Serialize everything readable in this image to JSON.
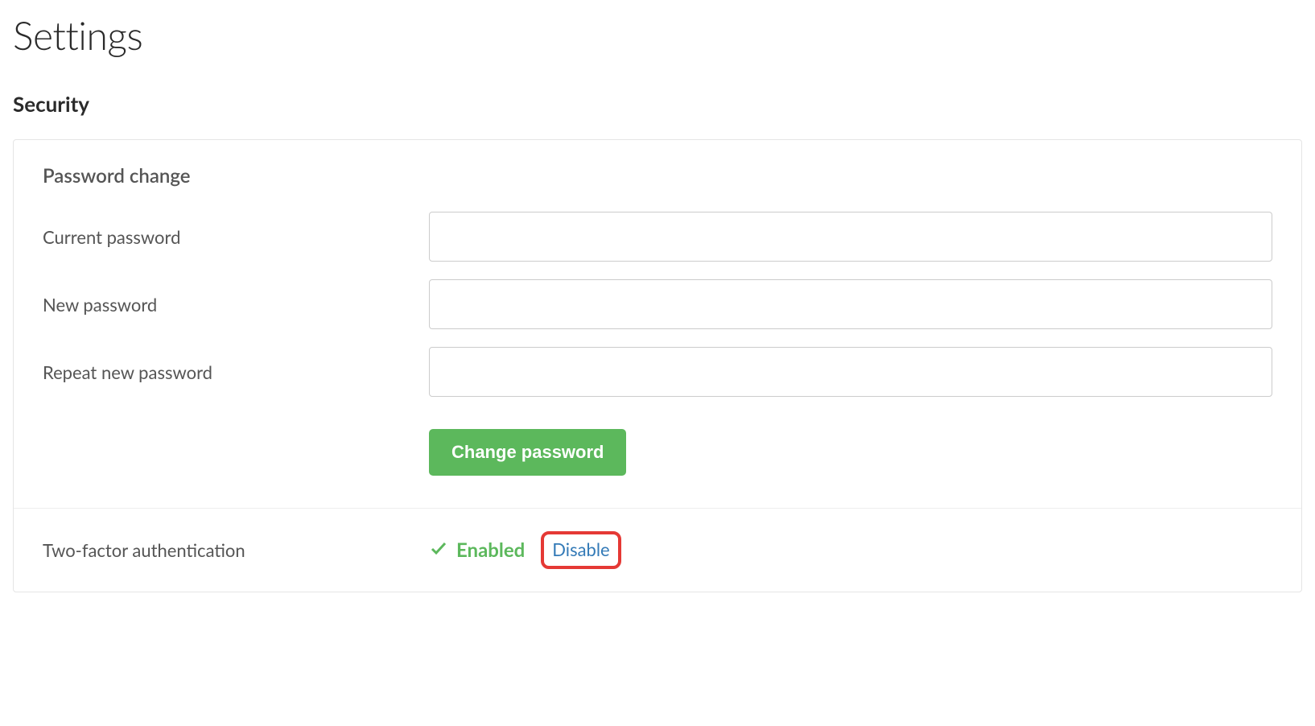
{
  "page": {
    "title": "Settings"
  },
  "security": {
    "heading": "Security",
    "password_change": {
      "heading": "Password change",
      "current_label": "Current password",
      "current_value": "",
      "new_label": "New password",
      "new_value": "",
      "repeat_label": "Repeat new password",
      "repeat_value": "",
      "submit_label": "Change password"
    },
    "two_factor": {
      "label": "Two-factor authentication",
      "status_text": "Enabled",
      "status_color": "#5cb85c",
      "disable_link_text": "Disable",
      "disable_link_highlighted": true
    }
  }
}
